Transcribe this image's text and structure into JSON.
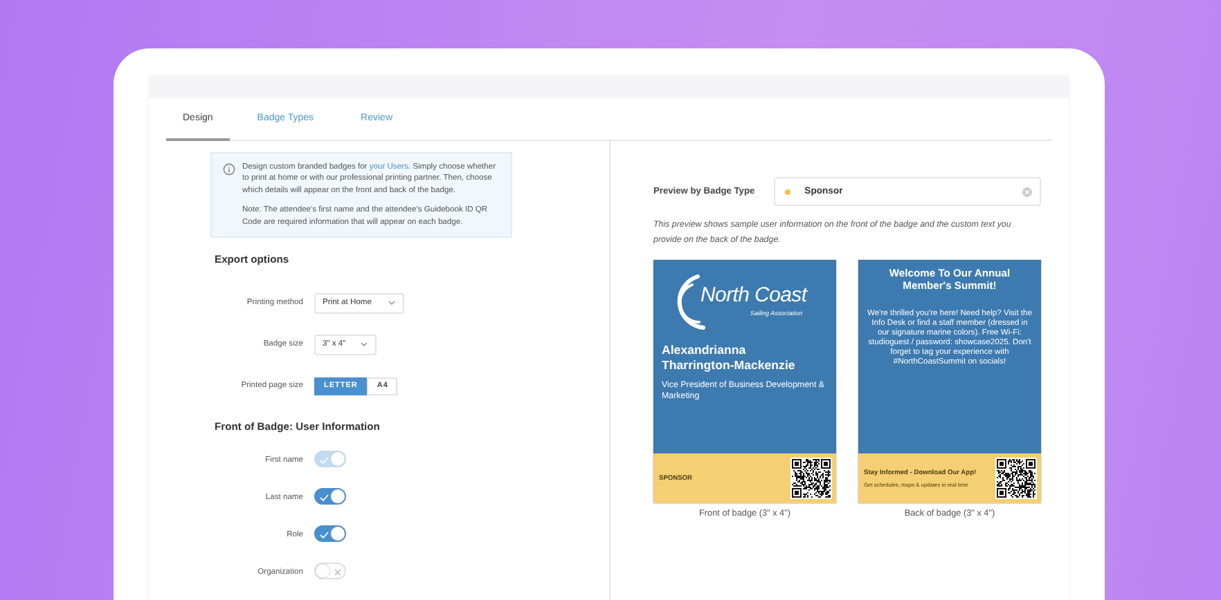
{
  "tabs": [
    {
      "label": "Design",
      "selected": true
    },
    {
      "label": "Badge Types",
      "selected": false
    },
    {
      "label": "Review",
      "selected": false
    }
  ],
  "info": {
    "text_before": "Design custom branded badges for ",
    "link": "your Users",
    "text_after": ". Simply choose whether to print at home or with our professional printing partner. Then, choose which details will appear on the front and back of the badge.",
    "note": "Note: The attendee's first name and the attendee's Guidebook ID QR Code are required information that will appear on each badge."
  },
  "export_options": {
    "title": "Export options",
    "printing_method": {
      "label": "Printing method",
      "value": "Print at Home"
    },
    "badge_size": {
      "label": "Badge size",
      "value": "3\" x 4\""
    },
    "page_size": {
      "label": "Printed page size",
      "options": [
        {
          "label": "LETTER",
          "selected": true
        },
        {
          "label": "A4",
          "selected": false
        }
      ]
    }
  },
  "front_info": {
    "title": "Front of Badge: User Information",
    "fields": [
      {
        "label": "First name",
        "on": true,
        "disabled": true
      },
      {
        "label": "Last name",
        "on": true,
        "disabled": false
      },
      {
        "label": "Role",
        "on": true,
        "disabled": false
      },
      {
        "label": "Organization",
        "on": false,
        "disabled": false
      }
    ]
  },
  "preview": {
    "label": "Preview by Badge Type",
    "badge_type": {
      "value": "Sponsor",
      "color": "#f2c04e"
    },
    "description": "This preview shows sample user information on the front of the badge and the custom text you provide on the back of the badge.",
    "front": {
      "logo_title": "North Coast",
      "logo_subtitle": "Sailing Association",
      "name": "Alexandrianna Tharrington-Mackenzie",
      "role": "Vice President of Business Development & Marketing",
      "badge_type": "SPONSOR",
      "caption": "Front of badge (3\" x 4\")"
    },
    "back": {
      "title": "Welcome To Our Annual Member's Summit!",
      "message": "We're thrilled you're here! Need help? Visit the Info Desk or find a staff member (dressed in our signature marine colors). Free Wi-Fi: studioguest / password: showcase2025. Don't forget to tag your experience with #NorthCoastSummit on socials!",
      "footer_title": "Stay Informed - Download Our App!",
      "footer_text": "Get schedules, maps & updates in real time",
      "caption": "Back of badge (3\" x 4\")"
    }
  }
}
